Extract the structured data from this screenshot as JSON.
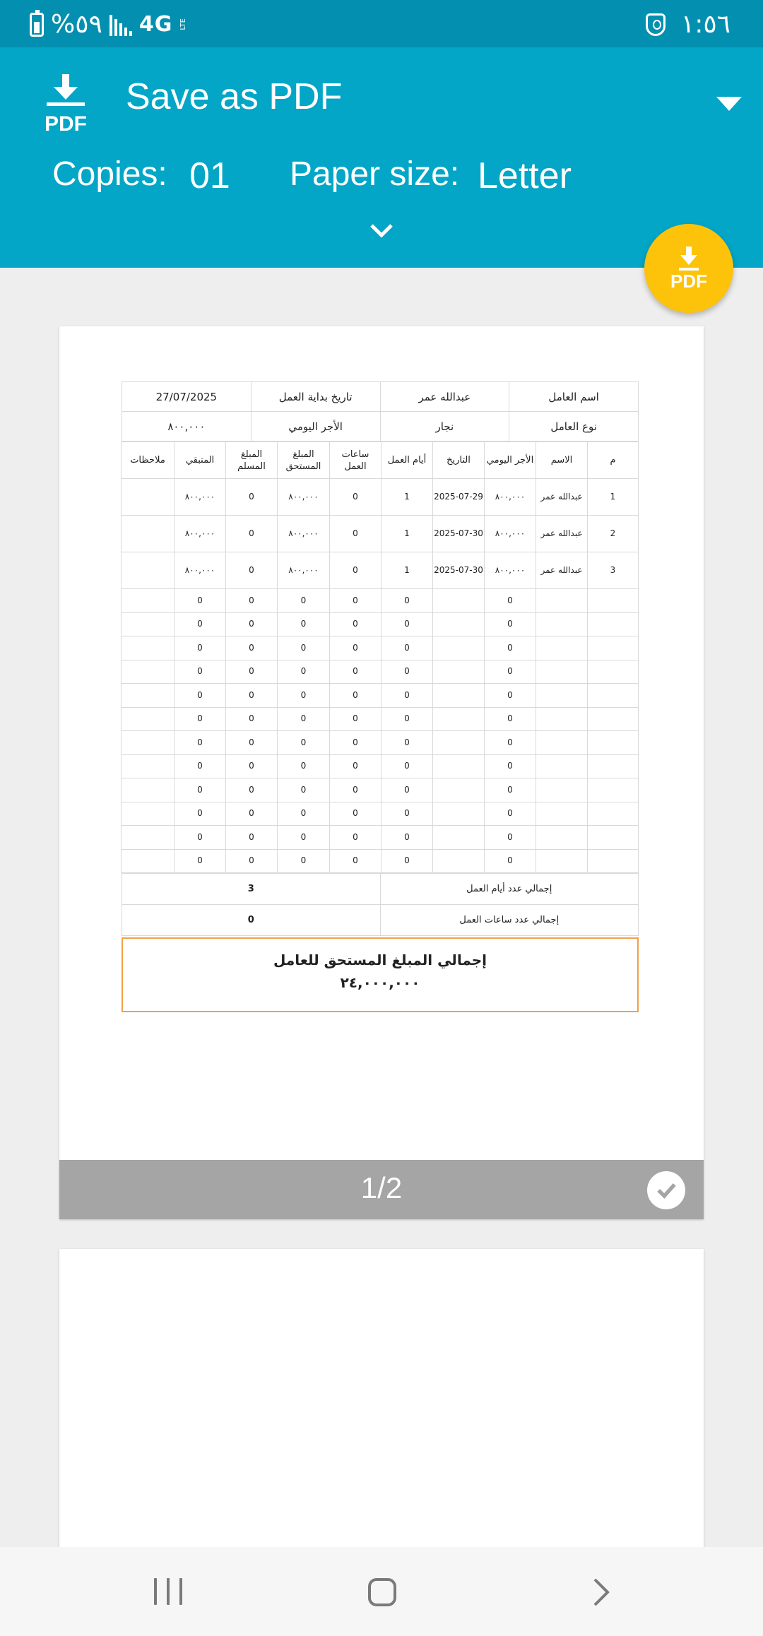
{
  "status_bar": {
    "battery_percent": "%٥٩",
    "network": "4G",
    "network_sub": "LTE",
    "time": "١:٥٦"
  },
  "header": {
    "icon_text": "PDF",
    "title": "Save as PDF",
    "copies_label": "Copies:",
    "copies_value": "01",
    "paper_label": "Paper size:",
    "paper_value": "Letter"
  },
  "fab": {
    "label": "PDF"
  },
  "document": {
    "info": {
      "worker_name_label": "اسم العامل",
      "worker_name": "عبدالله عمر",
      "start_date_label": "تاريخ بداية العمل",
      "start_date": "27/07/2025",
      "worker_type_label": "نوع العامل",
      "worker_type": "نجار",
      "daily_wage_label": "الأجر اليومي",
      "daily_wage": "٨٠٠,٠٠٠"
    },
    "columns": [
      "م",
      "الاسم",
      "الأجر اليومي",
      "التاريخ",
      "أيام العمل",
      "ساعات العمل",
      "المبلغ المستحق",
      "المبلغ المسلم",
      "المتبقي",
      "ملاحظات"
    ],
    "rows": [
      [
        "1",
        "عبدالله عمر",
        "٨٠٠,٠٠٠",
        "2025-07-29",
        "1",
        "0",
        "٨٠٠,٠٠٠",
        "0",
        "٨٠٠,٠٠٠",
        ""
      ],
      [
        "2",
        "عبدالله عمر",
        "٨٠٠,٠٠٠",
        "2025-07-30",
        "1",
        "0",
        "٨٠٠,٠٠٠",
        "0",
        "٨٠٠,٠٠٠",
        ""
      ],
      [
        "3",
        "عبدالله عمر",
        "٨٠٠,٠٠٠",
        "2025-07-30",
        "1",
        "0",
        "٨٠٠,٠٠٠",
        "0",
        "٨٠٠,٠٠٠",
        ""
      ],
      [
        "",
        "",
        "0",
        "",
        "0",
        "0",
        "0",
        "0",
        "0",
        ""
      ],
      [
        "",
        "",
        "0",
        "",
        "0",
        "0",
        "0",
        "0",
        "0",
        ""
      ],
      [
        "",
        "",
        "0",
        "",
        "0",
        "0",
        "0",
        "0",
        "0",
        ""
      ],
      [
        "",
        "",
        "0",
        "",
        "0",
        "0",
        "0",
        "0",
        "0",
        ""
      ],
      [
        "",
        "",
        "0",
        "",
        "0",
        "0",
        "0",
        "0",
        "0",
        ""
      ],
      [
        "",
        "",
        "0",
        "",
        "0",
        "0",
        "0",
        "0",
        "0",
        ""
      ],
      [
        "",
        "",
        "0",
        "",
        "0",
        "0",
        "0",
        "0",
        "0",
        ""
      ],
      [
        "",
        "",
        "0",
        "",
        "0",
        "0",
        "0",
        "0",
        "0",
        ""
      ],
      [
        "",
        "",
        "0",
        "",
        "0",
        "0",
        "0",
        "0",
        "0",
        ""
      ],
      [
        "",
        "",
        "0",
        "",
        "0",
        "0",
        "0",
        "0",
        "0",
        ""
      ],
      [
        "",
        "",
        "0",
        "",
        "0",
        "0",
        "0",
        "0",
        "0",
        ""
      ],
      [
        "",
        "",
        "0",
        "",
        "0",
        "0",
        "0",
        "0",
        "0",
        ""
      ]
    ],
    "total_days_label": "إجمالي عدد أيام العمل",
    "total_days": "3",
    "total_hours_label": "إجمالي عدد ساعات العمل",
    "total_hours": "0",
    "grand_total_label": "إجمالي المبلغ المستحق للعامل",
    "grand_total": "٢٤,٠٠٠,٠٠٠"
  },
  "page_indicator": "1/2"
}
